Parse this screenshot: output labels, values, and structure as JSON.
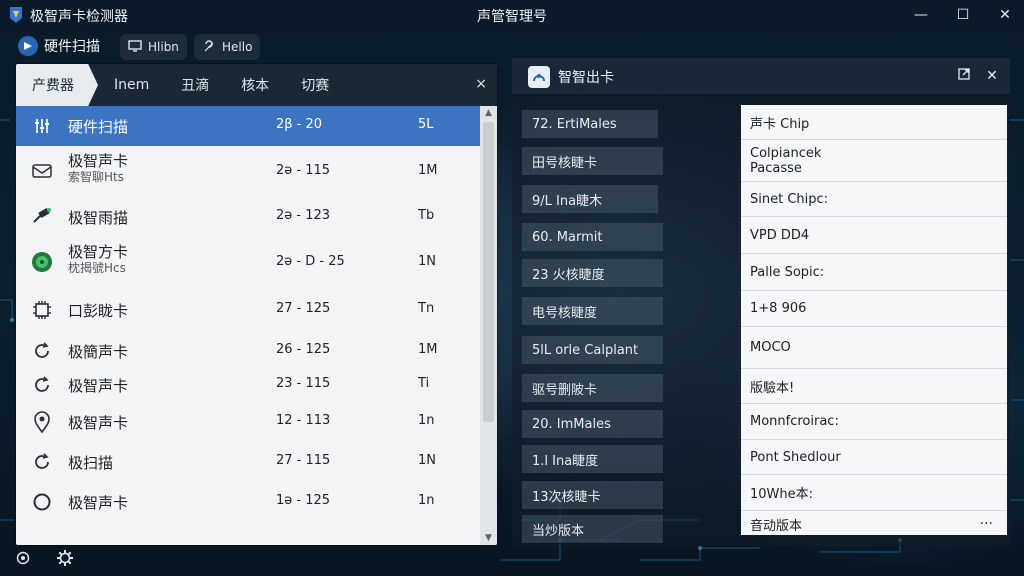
{
  "window": {
    "app_title": "极智声卡检测器",
    "center_title": "声管智理号",
    "controls": [
      "minimize-icon",
      "maximize-icon",
      "close-icon"
    ]
  },
  "toolbar": {
    "main_label": "硬件扫描",
    "btn1_label": "Hlibn",
    "btn2_label": "Hello"
  },
  "left_panel": {
    "tabs": [
      "产费器",
      "Inem",
      "丑滴",
      "核本",
      "切赛"
    ],
    "close_glyph": "×",
    "rows": [
      {
        "icon": "sliders-icon",
        "name": "硬件扫描",
        "sub": "",
        "range": "2β - 20",
        "unit": "5L",
        "selected": true
      },
      {
        "icon": "envelope-icon",
        "name": "极智声卡",
        "sub": "索智聊Hts",
        "range": "2ə - 115",
        "unit": "1M",
        "selected": false
      },
      {
        "icon": "satellite-icon",
        "name": "极智雨描",
        "sub": "",
        "range": "2ə - 123",
        "unit": "Tb",
        "selected": false
      },
      {
        "icon": "green-disc-icon",
        "name": "极智方卡",
        "sub": "枕揭號Hcs",
        "range": "2ə - D - 25",
        "unit": "1N",
        "selected": false
      },
      {
        "icon": "chip-icon",
        "name": "口彭眬卡",
        "sub": "",
        "range": "27 - 125",
        "unit": "Tn",
        "selected": false
      },
      {
        "icon": "refresh-icon",
        "name": "极簡声卡",
        "sub": "",
        "range": "26 - 125",
        "unit": "1M",
        "selected": false
      },
      {
        "icon": "refresh-icon",
        "name": "极智声卡",
        "sub": "",
        "range": "23 - 115",
        "unit": "Ti",
        "selected": false
      },
      {
        "icon": "location-icon",
        "name": "极智声卡",
        "sub": "",
        "range": "12 - 113",
        "unit": "1n",
        "selected": false
      },
      {
        "icon": "refresh-icon",
        "name": "极扫描",
        "sub": "",
        "range": "27 - 115",
        "unit": "1N",
        "selected": false
      },
      {
        "icon": "ring-icon",
        "name": "极智声卡",
        "sub": "",
        "range": "1ə - 125",
        "unit": "1n",
        "selected": false
      }
    ],
    "scroll_up": "▲",
    "scroll_down": "▼"
  },
  "right_panel": {
    "title": "智智出卡",
    "labels": [
      "72. ErtiMales",
      "田号核睫卡",
      "9/L Ina睫木",
      "60. Marmit",
      "23 火核睫度",
      "电号核睫度",
      "5lL orle Calplant",
      "驱号删陂卡",
      "20. ImMales",
      "1.l Ina睫度",
      "13次核睫卡",
      "当炒版本"
    ],
    "values": [
      {
        "text": "声卡 Chip",
        "sub": ""
      },
      {
        "text": "Colpiancek",
        "sub": "Pacasse"
      },
      {
        "text": "Sinet Chipc:",
        "sub": ""
      },
      {
        "text": "VPD DD4",
        "sub": ""
      },
      {
        "text": "Palle Sopic:",
        "sub": ""
      },
      {
        "text": "1+8 906",
        "sub": ""
      },
      {
        "text": "MOCO",
        "sub": ""
      },
      {
        "text": "版驗本!",
        "sub": ""
      },
      {
        "text": "Monnfcroirac:",
        "sub": ""
      },
      {
        "text": "Pont Shedlour",
        "sub": ""
      },
      {
        "text": "10Whe本:",
        "sub": ""
      },
      {
        "text": "音动版本",
        "sub": ""
      }
    ],
    "more_glyph": "···"
  },
  "bottom": {
    "icons": [
      "settings-icon",
      "gear-icon"
    ]
  }
}
